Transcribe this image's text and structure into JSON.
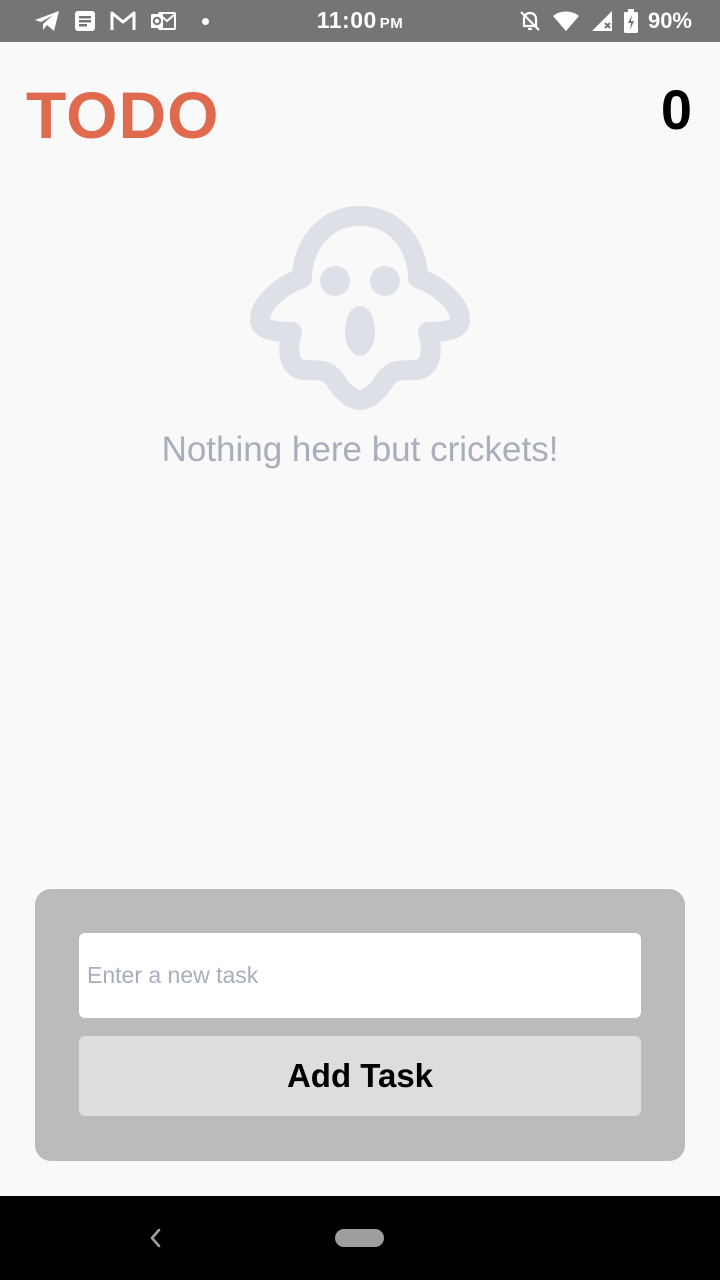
{
  "status_bar": {
    "time": "11:00",
    "ampm": "PM",
    "battery": "90%",
    "left_icons": [
      "telegram-icon",
      "news-icon",
      "gmail-icon",
      "outlook-icon",
      "notification-dot-icon"
    ],
    "right_icons": [
      "notifications-off-icon",
      "wifi-icon",
      "signal-icon",
      "battery-charging-icon"
    ]
  },
  "header": {
    "title": "TODO",
    "count": "0"
  },
  "empty_state": {
    "icon": "ghost-icon",
    "message": "Nothing here but crickets!"
  },
  "form": {
    "input_placeholder": "Enter a new task",
    "input_value": "",
    "button_label": "Add Task"
  },
  "nav_bar": {
    "icons": [
      "back-icon",
      "home-pill-icon"
    ]
  },
  "colors": {
    "accent": "#e06a4e",
    "background": "#f9f9f9",
    "panel": "#bbbbbb",
    "button": "#dddddd",
    "muted_text": "#a8aebb",
    "ghost": "#dde0e6",
    "status_bar": "#757575"
  }
}
